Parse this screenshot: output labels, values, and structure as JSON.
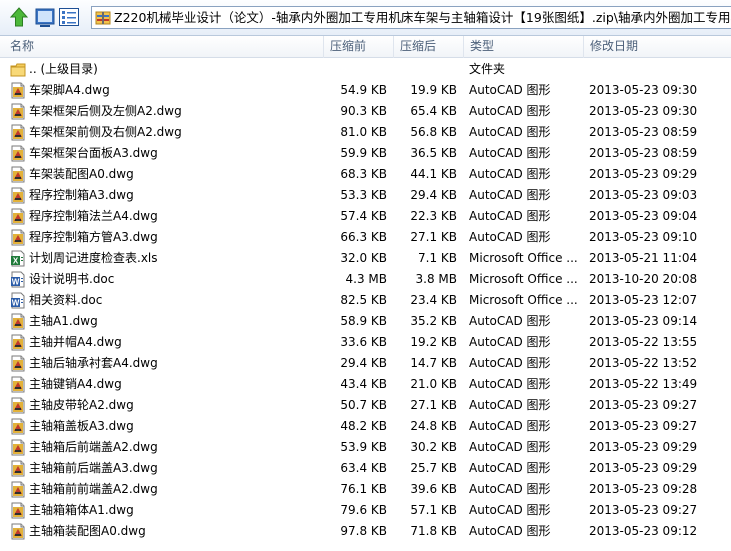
{
  "toolbar": {
    "up_icon": "up-arrow-icon",
    "view_icons": [
      "details-view-icon",
      "list-view-icon"
    ]
  },
  "path": {
    "icon": "archive-icon",
    "text": "Z220机械毕业设计（论文）-轴承内外圈加工专用机床车架与主轴箱设计【19张图纸】.zip\\轴承内外圈加工专用机床车"
  },
  "columns": {
    "name": "名称",
    "size": "压缩前",
    "compressed": "压缩后",
    "type": "类型",
    "modified": "修改日期"
  },
  "rows": [
    {
      "icon": "folder-up-icon",
      "name": ".. (上级目录)",
      "size": "",
      "compressed": "",
      "type": "文件夹",
      "modified": ""
    },
    {
      "icon": "dwg-file-icon",
      "name": "车架脚A4.dwg",
      "size": "54.9 KB",
      "compressed": "19.9 KB",
      "type": "AutoCAD 图形",
      "modified": "2013-05-23 09:30"
    },
    {
      "icon": "dwg-file-icon",
      "name": "车架框架后侧及左侧A2.dwg",
      "size": "90.3 KB",
      "compressed": "65.4 KB",
      "type": "AutoCAD 图形",
      "modified": "2013-05-23 09:30"
    },
    {
      "icon": "dwg-file-icon",
      "name": "车架框架前侧及右侧A2.dwg",
      "size": "81.0 KB",
      "compressed": "56.8 KB",
      "type": "AutoCAD 图形",
      "modified": "2013-05-23 08:59"
    },
    {
      "icon": "dwg-file-icon",
      "name": "车架框架台面板A3.dwg",
      "size": "59.9 KB",
      "compressed": "36.5 KB",
      "type": "AutoCAD 图形",
      "modified": "2013-05-23 08:59"
    },
    {
      "icon": "dwg-file-icon",
      "name": "车架装配图A0.dwg",
      "size": "68.3 KB",
      "compressed": "44.1 KB",
      "type": "AutoCAD 图形",
      "modified": "2013-05-23 09:29"
    },
    {
      "icon": "dwg-file-icon",
      "name": "程序控制箱A3.dwg",
      "size": "53.3 KB",
      "compressed": "29.4 KB",
      "type": "AutoCAD 图形",
      "modified": "2013-05-23 09:03"
    },
    {
      "icon": "dwg-file-icon",
      "name": "程序控制箱法兰A4.dwg",
      "size": "57.4 KB",
      "compressed": "22.3 KB",
      "type": "AutoCAD 图形",
      "modified": "2013-05-23 09:04"
    },
    {
      "icon": "dwg-file-icon",
      "name": "程序控制箱方管A3.dwg",
      "size": "66.3 KB",
      "compressed": "27.1 KB",
      "type": "AutoCAD 图形",
      "modified": "2013-05-23 09:10"
    },
    {
      "icon": "xls-file-icon",
      "name": "计划周记进度检查表.xls",
      "size": "32.0 KB",
      "compressed": "7.1 KB",
      "type": "Microsoft Office ...",
      "modified": "2013-05-21 11:04"
    },
    {
      "icon": "doc-file-icon",
      "name": "设计说明书.doc",
      "size": "4.3 MB",
      "compressed": "3.8 MB",
      "type": "Microsoft Office ...",
      "modified": "2013-10-20 20:08"
    },
    {
      "icon": "doc-file-icon",
      "name": "相关资料.doc",
      "size": "82.5 KB",
      "compressed": "23.4 KB",
      "type": "Microsoft Office ...",
      "modified": "2013-05-23 12:07"
    },
    {
      "icon": "dwg-file-icon",
      "name": "主轴A1.dwg",
      "size": "58.9 KB",
      "compressed": "35.2 KB",
      "type": "AutoCAD 图形",
      "modified": "2013-05-23 09:14"
    },
    {
      "icon": "dwg-file-icon",
      "name": "主轴并帽A4.dwg",
      "size": "33.6 KB",
      "compressed": "19.2 KB",
      "type": "AutoCAD 图形",
      "modified": "2013-05-22 13:55"
    },
    {
      "icon": "dwg-file-icon",
      "name": "主轴后轴承衬套A4.dwg",
      "size": "29.4 KB",
      "compressed": "14.7 KB",
      "type": "AutoCAD 图形",
      "modified": "2013-05-22 13:52"
    },
    {
      "icon": "dwg-file-icon",
      "name": "主轴键销A4.dwg",
      "size": "43.4 KB",
      "compressed": "21.0 KB",
      "type": "AutoCAD 图形",
      "modified": "2013-05-22 13:49"
    },
    {
      "icon": "dwg-file-icon",
      "name": "主轴皮带轮A2.dwg",
      "size": "50.7 KB",
      "compressed": "27.1 KB",
      "type": "AutoCAD 图形",
      "modified": "2013-05-23 09:27"
    },
    {
      "icon": "dwg-file-icon",
      "name": "主轴箱盖板A3.dwg",
      "size": "48.2 KB",
      "compressed": "24.8 KB",
      "type": "AutoCAD 图形",
      "modified": "2013-05-23 09:27"
    },
    {
      "icon": "dwg-file-icon",
      "name": "主轴箱后前端盖A2.dwg",
      "size": "53.9 KB",
      "compressed": "30.2 KB",
      "type": "AutoCAD 图形",
      "modified": "2013-05-23 09:29"
    },
    {
      "icon": "dwg-file-icon",
      "name": "主轴箱前后端盖A3.dwg",
      "size": "63.4 KB",
      "compressed": "25.7 KB",
      "type": "AutoCAD 图形",
      "modified": "2013-05-23 09:29"
    },
    {
      "icon": "dwg-file-icon",
      "name": "主轴箱前前端盖A2.dwg",
      "size": "76.1 KB",
      "compressed": "39.6 KB",
      "type": "AutoCAD 图形",
      "modified": "2013-05-23 09:28"
    },
    {
      "icon": "dwg-file-icon",
      "name": "主轴箱箱体A1.dwg",
      "size": "79.6 KB",
      "compressed": "57.1 KB",
      "type": "AutoCAD 图形",
      "modified": "2013-05-23 09:27"
    },
    {
      "icon": "dwg-file-icon",
      "name": "主轴箱装配图A0.dwg",
      "size": "97.8 KB",
      "compressed": "71.8 KB",
      "type": "AutoCAD 图形",
      "modified": "2013-05-23 09:12"
    }
  ]
}
